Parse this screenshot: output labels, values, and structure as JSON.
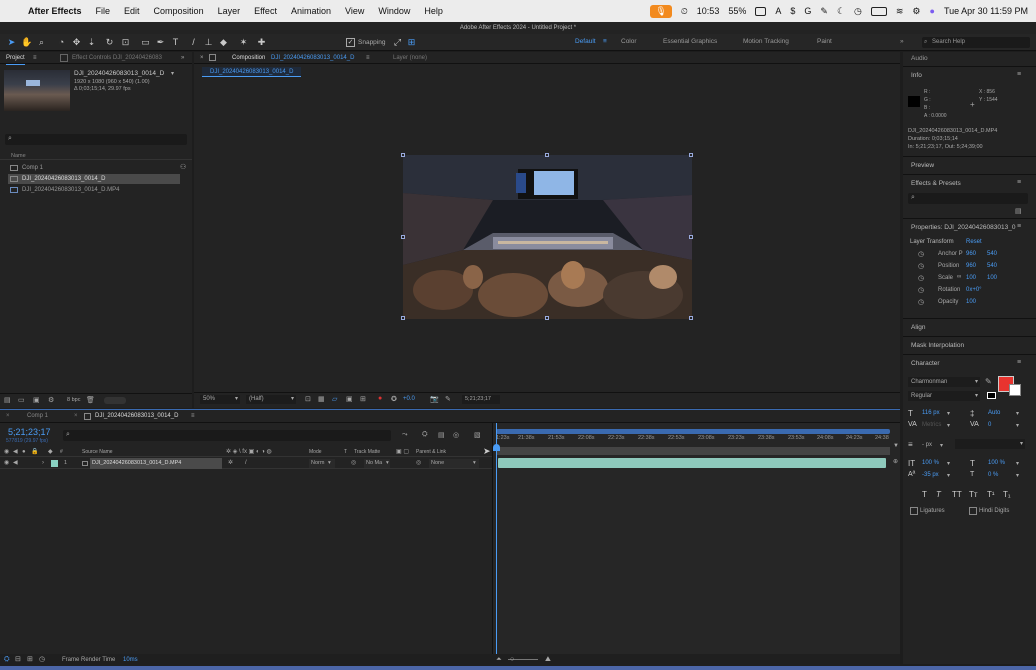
{
  "menubar": {
    "app_name": "After Effects",
    "items": [
      "File",
      "Edit",
      "Composition",
      "Layer",
      "Effect",
      "Animation",
      "View",
      "Window",
      "Help"
    ],
    "clock": "10:53",
    "battery": "55%",
    "date_time": "Tue Apr 30  11:59 PM"
  },
  "window_title": "Adobe After Effects 2024 - Untitled Project *",
  "toolbar": {
    "snapping_label": "Snapping",
    "workspaces": [
      "Default",
      "Color",
      "Essential Graphics",
      "Motion Tracking",
      "Paint"
    ],
    "active_workspace": "Default",
    "search_placeholder": "Search Help"
  },
  "project_panel": {
    "tab_label": "Project",
    "effect_controls_label": "Effect Controls DJI_20240426083",
    "selected_name": "DJI_20240426083013_0014_D",
    "selected_info1": "1920 x 1080  (960 x 540) (1.00)",
    "selected_info2": "Δ 0;03;15;14, 29.97 fps",
    "search_placeholder": "",
    "column_name": "Name",
    "items": [
      {
        "label": "Comp 1",
        "selected": false
      },
      {
        "label": "DJI_20240426083013_0014_D",
        "selected": true
      },
      {
        "label": "DJI_20240426083013_0014_D.MP4",
        "selected": false
      }
    ],
    "bpc": "8 bpc"
  },
  "viewer": {
    "comp_tab_prefix": "Composition",
    "comp_tab_name": "DJI_20240426083013_0014_D",
    "layer_tab": "Layer (none)",
    "sub_tab": "DJI_20240426083013_0014_D",
    "zoom": "50%",
    "resolution": "(Half)",
    "exposure": "+0.0",
    "timecode": "5;21;23;17"
  },
  "info_panel": {
    "audio": "Audio",
    "title": "Info",
    "r": "R :",
    "g": "G :",
    "b": "B :",
    "a": "A : 0.0000",
    "x": "X : 856",
    "y": "Y : 1544",
    "file": "DJI_20240426083013_0014_D.MP4",
    "duration": "Duration: 0;03;15;14",
    "in_out": "In: 5;21;23;17, Out: 5;24;39;00",
    "preview": "Preview",
    "effects_presets": "Effects & Presets",
    "properties_title": "Properties: DJI_20240426083013_0",
    "layer_transform": "Layer Transform",
    "reset": "Reset",
    "props": [
      {
        "name": "Anchor P",
        "v1": "960",
        "v2": "540"
      },
      {
        "name": "Position",
        "v1": "960",
        "v2": "540"
      },
      {
        "name": "Scale",
        "v1": "100",
        "v2": "100"
      },
      {
        "name": "Rotation",
        "v1": "0x+0°",
        "v2": ""
      },
      {
        "name": "Opacity",
        "v1": "100",
        "v2": ""
      }
    ],
    "align": "Align",
    "mask_interp": "Mask Interpolation",
    "character": "Character",
    "font": "Charmonman",
    "font_style": "Regular",
    "font_size": "116 px",
    "leading": "Auto",
    "kerning": "Metrics",
    "tracking": "0",
    "stroke_px": "- px",
    "vscale": "100 %",
    "hscale": "100 %",
    "baseline": "-35 px",
    "tsume": "0 %",
    "ligatures": "Ligatures",
    "hindi": "Hindi Digits",
    "fill_color": "#e8342f"
  },
  "timeline": {
    "tab_comp1": "Comp 1",
    "tab_active": "DJI_20240426083013_0014_D",
    "current_time": "5;21;23;17",
    "frames": "577819 (29.97 fps)",
    "col_source": "Source Name",
    "col_mode": "Mode",
    "col_t": "T",
    "col_trackmatte": "Track Matte",
    "col_parent": "Parent & Link",
    "layer_num": "1",
    "layer_name": "DJI_20240426083013_0014_D.MP4",
    "layer_mode": "Norm",
    "layer_matte": "No Ma",
    "layer_parent": "None",
    "ruler": [
      "1:23s",
      "21:38s",
      "21:53s",
      "22:08s",
      "22:23s",
      "22:38s",
      "22:53s",
      "23:08s",
      "23:23s",
      "23:38s",
      "23:53s",
      "24:08s",
      "24:23s",
      "24:38"
    ],
    "render_time_label": "Frame Render Time",
    "render_time_value": "10ms"
  }
}
